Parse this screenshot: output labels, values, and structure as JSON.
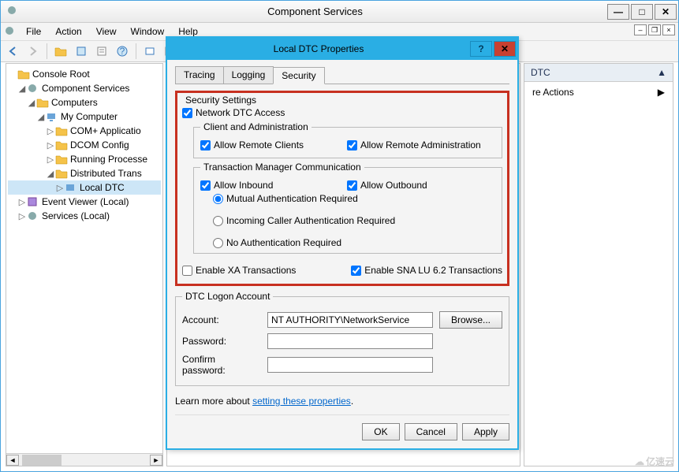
{
  "window": {
    "title": "Component Services",
    "menu": [
      "File",
      "Action",
      "View",
      "Window",
      "Help"
    ]
  },
  "tree": {
    "root": "Console Root",
    "cs": "Component Services",
    "computers": "Computers",
    "mycomp": "My Computer",
    "com": "COM+ Applicatio",
    "dcom": "DCOM Config",
    "running": "Running Processe",
    "dtc": "Distributed Trans",
    "localdtc": "Local DTC",
    "ev": "Event Viewer (Local)",
    "svc": "Services (Local)"
  },
  "actions": {
    "header": "DTC",
    "more": "re Actions"
  },
  "dialog": {
    "title": "Local DTC Properties",
    "tabs": [
      "Tracing",
      "Logging",
      "Security"
    ],
    "security": {
      "legend": "Security Settings",
      "netdtc": "Network DTC Access",
      "clientadmin_legend": "Client and Administration",
      "allow_remote_clients": "Allow Remote Clients",
      "allow_remote_admin": "Allow Remote Administration",
      "tmc_legend": "Transaction Manager Communication",
      "allow_inbound": "Allow Inbound",
      "allow_outbound": "Allow Outbound",
      "r1": "Mutual Authentication Required",
      "r2": "Incoming Caller Authentication Required",
      "r3": "No Authentication Required",
      "xa": "Enable XA Transactions",
      "sna": "Enable SNA LU 6.2 Transactions"
    },
    "logon": {
      "legend": "DTC Logon Account",
      "account_label": "Account:",
      "account_value": "NT AUTHORITY\\NetworkService",
      "browse": "Browse...",
      "password_label": "Password:",
      "confirm_label": "Confirm password:"
    },
    "learn_prefix": "Learn more about ",
    "learn_link": "setting these properties",
    "buttons": {
      "ok": "OK",
      "cancel": "Cancel",
      "apply": "Apply"
    }
  },
  "watermark": "亿速云"
}
